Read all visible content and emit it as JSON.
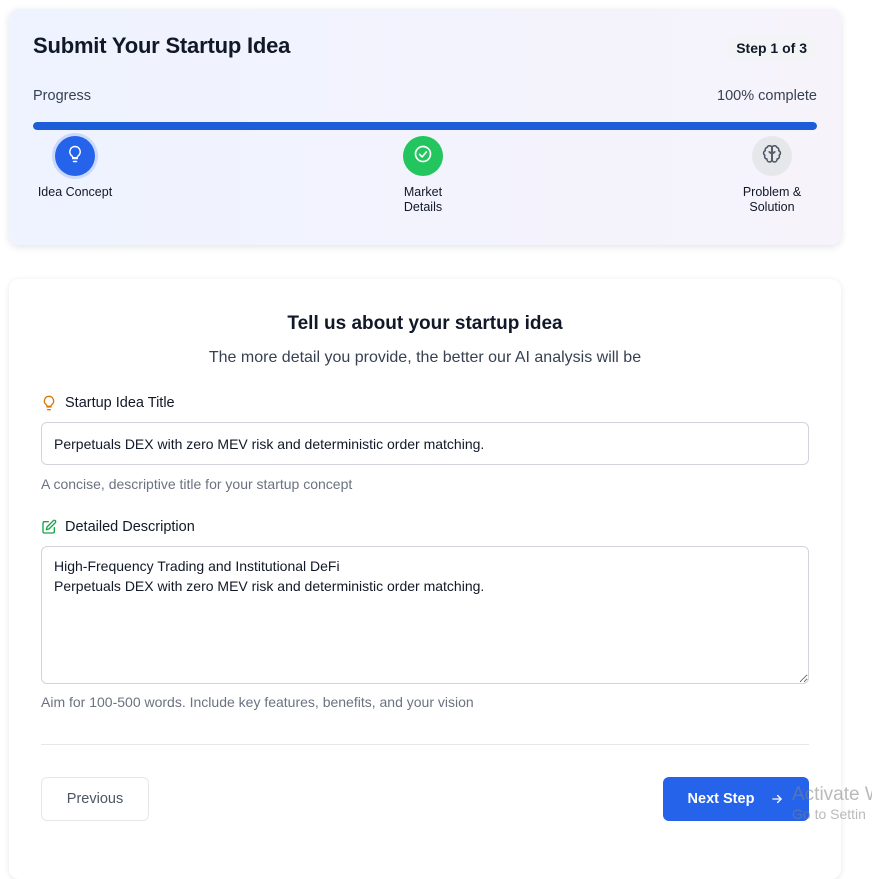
{
  "header": {
    "title": "Submit Your Startup Idea",
    "step_badge": "Step 1 of 3",
    "progress_label": "Progress",
    "progress_text": "100% complete",
    "progress_value": 1.0,
    "accent_color": "#2563eb"
  },
  "steps": [
    {
      "label": "Idea Concept",
      "icon": "lightbulb-icon",
      "status": "current",
      "color": "#2563eb"
    },
    {
      "label": "Market\nDetails",
      "icon": "check-circle-icon",
      "status": "completed",
      "color": "#22c55e"
    },
    {
      "label": "Problem &\nSolution",
      "icon": "brain-icon",
      "status": "upcoming",
      "color": "#e5e7eb"
    }
  ],
  "form": {
    "heading": "Tell us about your startup idea",
    "subheading": "The more detail you provide, the better our AI analysis will be",
    "title_field": {
      "label": "Startup Idea Title",
      "icon": "lightbulb-icon",
      "value": "Perpetuals DEX with zero MEV risk and deterministic order matching.",
      "help": "A concise, descriptive title for your startup concept"
    },
    "description_field": {
      "label": "Detailed Description",
      "icon": "edit-icon",
      "value": "High-Frequency Trading and Institutional DeFi\nPerpetuals DEX with zero MEV risk and deterministic order matching.",
      "help": "Aim for 100-500 words. Include key features, benefits, and your vision"
    },
    "prev_label": "Previous",
    "next_label": "Next Step"
  },
  "watermark": {
    "line1": "Activate W",
    "line2": "Go to Settin"
  }
}
